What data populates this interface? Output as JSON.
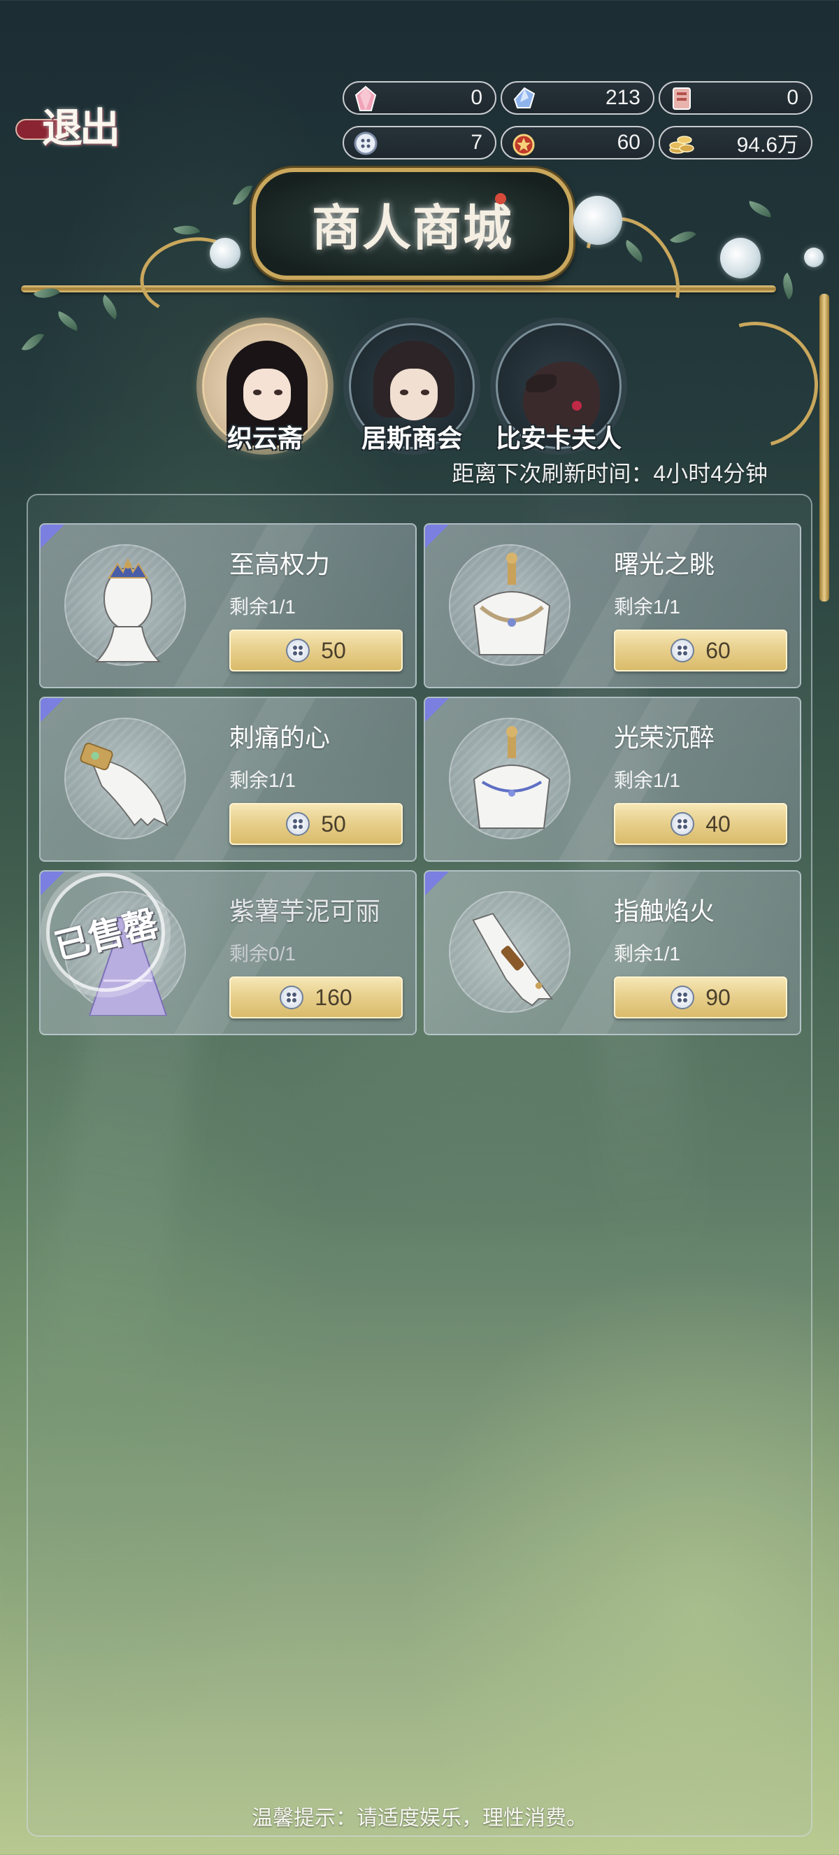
{
  "header": {
    "exit_label": "退出",
    "resources": [
      {
        "icon": "pink-crystal-icon",
        "value": "0"
      },
      {
        "icon": "blue-crystal-icon",
        "value": "213"
      },
      {
        "icon": "red-ticket-icon",
        "value": "0"
      },
      {
        "icon": "button-token-icon",
        "value": "7"
      },
      {
        "icon": "star-badge-icon",
        "value": "60"
      },
      {
        "icon": "gold-coins-icon",
        "value": "94.6万"
      }
    ]
  },
  "sign": {
    "title": "商人商城"
  },
  "merchants": [
    {
      "name": "织云斋",
      "active": true
    },
    {
      "name": "居斯商会",
      "active": false
    },
    {
      "name": "比安卡夫人",
      "active": false
    }
  ],
  "refresh_text": "距离下次刷新时间：4小时4分钟",
  "items": [
    {
      "name": "至高权力",
      "remaining": "剩余1/1",
      "price": "50",
      "sold": false,
      "icon": "crown-mannequin-icon"
    },
    {
      "name": "曙光之眺",
      "remaining": "剩余1/1",
      "price": "60",
      "sold": false,
      "icon": "necklace-bust-icon"
    },
    {
      "name": "刺痛的心",
      "remaining": "剩余1/1",
      "price": "50",
      "sold": false,
      "icon": "glove-bracelet-icon"
    },
    {
      "name": "光荣沉醉",
      "remaining": "剩余1/1",
      "price": "40",
      "sold": false,
      "icon": "choker-bust-icon"
    },
    {
      "name": "紫薯芋泥可丽",
      "remaining": "剩余0/1",
      "price": "160",
      "sold": true,
      "icon": "dress-icon"
    },
    {
      "name": "指触焰火",
      "remaining": "剩余1/1",
      "price": "90",
      "sold": false,
      "icon": "glove-ring-icon"
    }
  ],
  "sold_stamp": "已售罄",
  "currency_icon": "button-token-icon",
  "tip": "温馨提示：请适度娱乐，理性消费。",
  "colors": {
    "accent_gold": "#e8d08e",
    "rarity_corner": "#7a7fe0",
    "active_tab": "#f3e3c8"
  }
}
